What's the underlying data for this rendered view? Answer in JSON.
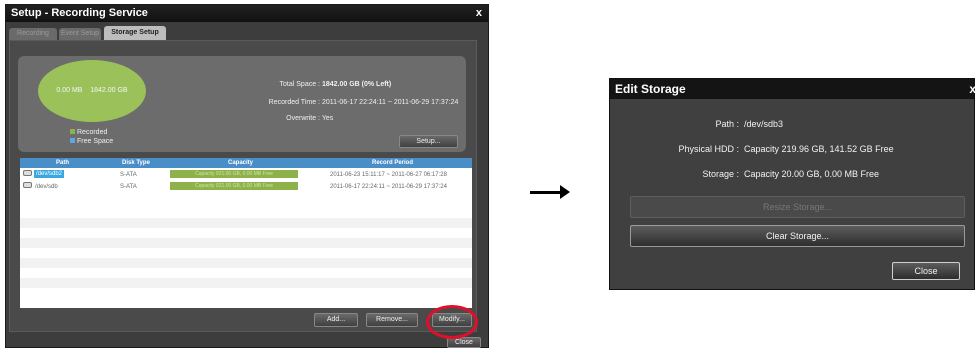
{
  "setup_window": {
    "title": "Setup - Recording Service",
    "close_glyph": "x",
    "tabs": [
      {
        "label": "Recording Setup"
      },
      {
        "label": "Event Setup"
      },
      {
        "label": "Storage Setup"
      }
    ],
    "pie": {
      "recorded_label": "0.00 MB",
      "free_label": "1842.00 GB",
      "recorded_color": "#5ca8e0",
      "free_color": "#9bc25a"
    },
    "legend": [
      {
        "label": "Recorded",
        "color": "#8db24a"
      },
      {
        "label": "Free Space",
        "color": "#5ca8e0"
      }
    ],
    "info": {
      "total_space_key": "Total Space :",
      "total_space_value": "1842.00 GB (0% Left)",
      "recorded_time_key": "Recorded Time :",
      "recorded_time_value": "2011-06-17  22:24:11 ~ 2011-06-29  17:37:24",
      "overwrite_key": "Overwrite :",
      "overwrite_value": "Yes"
    },
    "setup_button": "Setup...",
    "table": {
      "columns": [
        "Path",
        "Disk Type",
        "Capacity",
        "Record Period"
      ],
      "rows": [
        {
          "path": "/dev/sdb2",
          "disk_type": "S-ATA",
          "capacity": "Capacity 921.00 GB, 0.00 MB Free",
          "period": "2011-06-23  15:11:17 ~ 2011-06-27  06:17:28"
        },
        {
          "path": "/dev/sdb",
          "disk_type": "S-ATA",
          "capacity": "Capacity 921.00 GB, 0.00 MB Free",
          "period": "2011-06-17  22:24:11 ~ 2011-06-29  17:37:24"
        }
      ]
    },
    "buttons": {
      "add": "Add...",
      "remove": "Remove...",
      "modify": "Modify...",
      "close": "Close"
    }
  },
  "arrow": {
    "color": "#000000"
  },
  "highlight": {
    "color": "#e0102a"
  },
  "edit_storage_window": {
    "title": "Edit Storage",
    "close_glyph": "x",
    "path_key": "Path :",
    "path_value": "/dev/sdb3",
    "hdd_key": "Physical HDD :",
    "hdd_value": "Capacity 219.96 GB, 141.52 GB Free",
    "storage_key": "Storage :",
    "storage_value": "Capacity 20.00 GB, 0.00 MB Free",
    "resize_button": "Resize Storage...",
    "clear_button": "Clear Storage...",
    "close_button": "Close"
  }
}
